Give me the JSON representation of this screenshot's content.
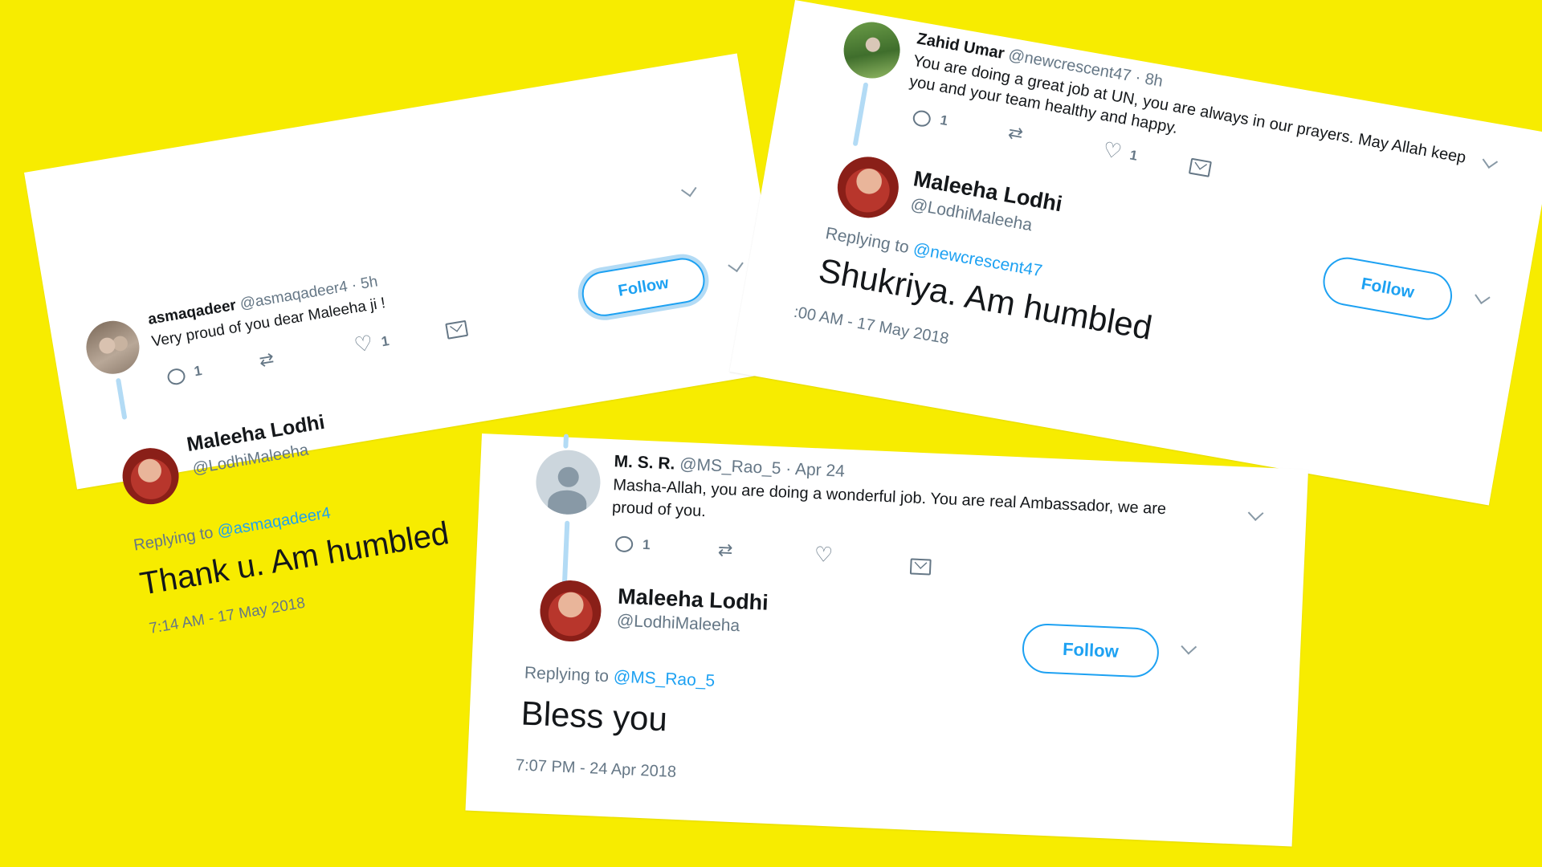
{
  "tweets": [
    {
      "parent": {
        "name": "asmaqadeer",
        "handle": "@asmaqadeer4 · 5h",
        "text": "Very proud of you dear Maleeha ji !",
        "reply_count": "1",
        "like_count": "1"
      },
      "reply": {
        "name": "Maleeha Lodhi",
        "handle": "@LodhiMaleeha",
        "replying_prefix": "Replying to",
        "replying_to": "@asmaqadeer4",
        "text": "Thank u. Am humbled",
        "timestamp": "7:14 AM - 17 May 2018",
        "follow_label": "Follow"
      }
    },
    {
      "parent": {
        "name": "Zahid Umar",
        "handle": "@newcrescent47 · 8h",
        "text_line1": "You are doing a great job at UN, you are always in our prayers. May Allah keep",
        "text_line2": "you and your team healthy and happy.",
        "reply_count": "1",
        "like_count": "1"
      },
      "reply": {
        "name": "Maleeha Lodhi",
        "handle": "@LodhiMaleeha",
        "replying_prefix": "Replying to",
        "replying_to": "@newcrescent47",
        "text": "Shukriya. Am humbled",
        "timestamp": ":00 AM - 17 May 2018",
        "follow_label": "Follow"
      }
    },
    {
      "parent": {
        "name": "M. S. R.",
        "handle": "@MS_Rao_5 · Apr 24",
        "text_line1": "Masha-Allah, you are doing a wonderful job. You are real Ambassador, we are",
        "text_line2": "proud of you.",
        "reply_count": "1"
      },
      "reply": {
        "name": "Maleeha Lodhi",
        "handle": "@LodhiMaleeha",
        "replying_prefix": "Replying to",
        "replying_to": "@MS_Rao_5",
        "text": "Bless you",
        "timestamp": "7:07 PM - 24 Apr 2018",
        "follow_label": "Follow"
      }
    }
  ],
  "colors": {
    "background": "#f7ec00",
    "accent": "#1da1f2",
    "thread_line": "#b3dbf5"
  },
  "icons": [
    "reply-icon",
    "retweet-icon",
    "like-icon",
    "direct-message-icon",
    "chevron-down-icon"
  ]
}
